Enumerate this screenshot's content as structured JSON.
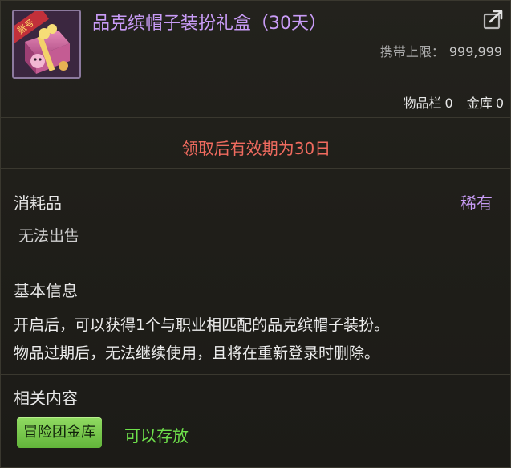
{
  "item": {
    "title": "品克缤帽子装扮礼盒（30天）",
    "icon": "pink-gift-box-icon",
    "badge": "账号"
  },
  "limit": {
    "label": "携带上限：",
    "value": "999,999"
  },
  "storage": {
    "inventory_label": "物品栏",
    "inventory_count": "0",
    "vault_label": "金库",
    "vault_count": "0"
  },
  "expiry_text": "领取后有效期为30日",
  "category": {
    "label": "消耗品",
    "rarity": "稀有",
    "sell_note": "无法出售"
  },
  "basic_info": {
    "title": "基本信息",
    "lines": [
      "开启后，可以获得1个与职业相匹配的品克缤帽子装扮。",
      "物品过期后，无法继续使用，且将在重新登录时删除。"
    ]
  },
  "related": {
    "title": "相关内容",
    "tag_label": "冒险团金库",
    "tag_desc": "可以存放"
  },
  "colors": {
    "title": "#c99cf7",
    "expiry": "#f06b5f",
    "rarity": "#c99cf7",
    "tag_bg": "#7cc94d",
    "tag_text": "#6ee04b"
  }
}
